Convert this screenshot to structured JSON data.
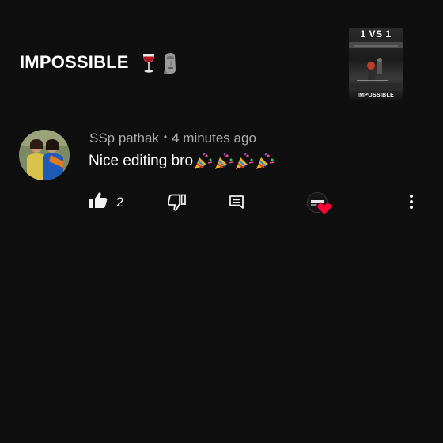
{
  "video": {
    "title": "IMPOSSIBLE",
    "title_emojis": [
      "wine-glass-icon",
      "moai-icon"
    ],
    "thumbnail": {
      "top_text": "1 VS 1",
      "bottom_text": "IMPOSSIBLE"
    }
  },
  "comment": {
    "author": "SSp pathak",
    "separator": "•",
    "time": "4 minutes ago",
    "text": "Nice editing bro",
    "text_emojis": [
      "party-popper-icon",
      "party-popper-icon",
      "party-popper-icon",
      "party-popper-icon"
    ],
    "like_count": "2",
    "creator_heart": true
  },
  "colors": {
    "background": "#0f0f0f",
    "primary_text": "#f1f1f1",
    "secondary_text": "#aaaaaa",
    "heart": "#ff0033"
  }
}
